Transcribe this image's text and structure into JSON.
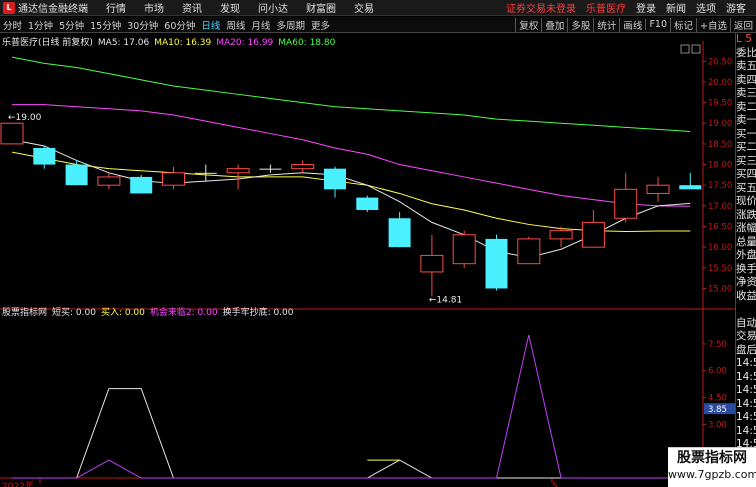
{
  "menu": {
    "app_title": "通达信金融终端",
    "items": [
      "行情",
      "市场",
      "资讯",
      "发现",
      "问小达",
      "财富圈",
      "交易"
    ],
    "alert": "证券交易未登录",
    "stock_link": "乐普医疗",
    "right_items": [
      "登录",
      "新闻",
      "选项"
    ],
    "guest": "游客"
  },
  "periods": [
    "分时",
    "1分钟",
    "5分钟",
    "15分钟",
    "30分钟",
    "60分钟",
    "日线",
    "周线",
    "月线",
    "多周期",
    "更多"
  ],
  "active_period": "日线",
  "tools": [
    "复权",
    "叠加",
    "多股",
    "统计",
    "画线",
    "F10",
    "标记",
    "+自选",
    "返回"
  ],
  "ma_header": {
    "stock": "乐普医疗(日线 前复权)",
    "items": [
      {
        "label": "MA5: 17.06",
        "color": "#e8e8e8"
      },
      {
        "label": "MA10: 16.39",
        "color": "#ffff4a"
      },
      {
        "label": "MA20: 16.99",
        "color": "#ff4aff"
      },
      {
        "label": "MA60: 18.80",
        "color": "#4aff4a"
      }
    ]
  },
  "indicator_header": {
    "name": "股票指标网",
    "items": [
      {
        "label": "短买: 0.00",
        "color": "#e8e8e8"
      },
      {
        "label": "买入: 0.00",
        "color": "#ffff4a"
      },
      {
        "label": "机会来临2: 0.00",
        "color": "#ff4aff"
      },
      {
        "label": "换手牢抄底: 0.00",
        "color": "#e8e8e8"
      }
    ]
  },
  "right_panel": [
    {
      "text": "委比",
      "red": false
    },
    {
      "text": "卖五",
      "red": false
    },
    {
      "text": "卖四",
      "red": false
    },
    {
      "text": "卖三",
      "red": false
    },
    {
      "text": "卖二",
      "red": false
    },
    {
      "text": "卖一",
      "red": false
    },
    {
      "text": "买一",
      "red": false
    },
    {
      "text": "买二",
      "red": false
    },
    {
      "text": "买三",
      "red": false
    },
    {
      "text": "买四",
      "red": false
    },
    {
      "text": "买五",
      "red": false
    },
    {
      "text": "现价",
      "red": false
    },
    {
      "text": "涨跌",
      "red": false
    },
    {
      "text": "涨幅",
      "red": false
    },
    {
      "text": "总量",
      "red": false
    },
    {
      "text": "外盘",
      "red": false
    },
    {
      "text": "换手",
      "red": false
    },
    {
      "text": "净资",
      "red": false
    },
    {
      "text": "收益",
      "red": false
    },
    {
      "text": "",
      "red": false
    },
    {
      "text": "自动",
      "red": false
    },
    {
      "text": "交易",
      "red": false
    },
    {
      "text": "盘后",
      "red": false
    },
    {
      "text": "14:5",
      "red": false
    },
    {
      "text": "14:5",
      "red": false
    },
    {
      "text": "14:5",
      "red": false
    },
    {
      "text": "14:5",
      "red": false
    },
    {
      "text": "14:5",
      "red": false
    },
    {
      "text": "14:5",
      "red": false
    },
    {
      "text": "14:5",
      "red": false
    },
    {
      "text": "14:5",
      "red": false
    },
    {
      "text": "14:5",
      "red": false
    }
  ],
  "right_panel_top": "L 5",
  "price_axis": [
    "20.50",
    "20.00",
    "19.50",
    "19.00",
    "18.50",
    "18.00",
    "17.50",
    "17.00",
    "16.50",
    "16.00",
    "15.50",
    "15.00"
  ],
  "indicator_axis": [
    "7.50",
    "6.00",
    "4.50",
    "3.00",
    "1.50"
  ],
  "indicator_current": "3.85",
  "x_labels": [
    "2022年",
    "5"
  ],
  "annotations": {
    "high": "19.00",
    "low": "14.81"
  },
  "colors": {
    "up": "#ff4a4a",
    "down": "#4af0ff",
    "ma5": "#e8e8e8",
    "ma10": "#ffff4a",
    "ma20": "#ff4aff",
    "ma60": "#4aff4a",
    "axis": "#c01818"
  },
  "watermark": {
    "title": "股票指标网",
    "url": "www.7gpzb.com"
  },
  "chart_data": {
    "type": "candlestick",
    "ylim": [
      14.6,
      20.7
    ],
    "candles": [
      {
        "o": 18.5,
        "c": 19.0,
        "h": 19.0,
        "l": 18.5
      },
      {
        "o": 18.4,
        "c": 18.0,
        "h": 18.45,
        "l": 17.9
      },
      {
        "o": 18.0,
        "c": 17.5,
        "h": 18.1,
        "l": 17.5
      },
      {
        "o": 17.5,
        "c": 17.7,
        "h": 17.8,
        "l": 17.4
      },
      {
        "o": 17.7,
        "c": 17.3,
        "h": 17.75,
        "l": 17.3
      },
      {
        "o": 17.5,
        "c": 17.8,
        "h": 17.95,
        "l": 17.4
      },
      {
        "o": 17.8,
        "c": 17.8,
        "h": 18.0,
        "l": 17.6
      },
      {
        "o": 17.8,
        "c": 17.9,
        "h": 18.0,
        "l": 17.4
      },
      {
        "o": 17.9,
        "c": 17.9,
        "h": 18.0,
        "l": 17.8
      },
      {
        "o": 17.9,
        "c": 18.0,
        "h": 18.1,
        "l": 17.8
      },
      {
        "o": 17.9,
        "c": 17.4,
        "h": 17.95,
        "l": 17.2
      },
      {
        "o": 17.2,
        "c": 16.9,
        "h": 17.25,
        "l": 16.85
      },
      {
        "o": 16.7,
        "c": 16.0,
        "h": 16.85,
        "l": 16.0
      },
      {
        "o": 15.4,
        "c": 15.8,
        "h": 16.3,
        "l": 14.81
      },
      {
        "o": 15.6,
        "c": 16.3,
        "h": 16.4,
        "l": 15.5
      },
      {
        "o": 16.2,
        "c": 15.0,
        "h": 16.3,
        "l": 14.95
      },
      {
        "o": 15.6,
        "c": 16.2,
        "h": 16.25,
        "l": 15.6
      },
      {
        "o": 16.2,
        "c": 16.4,
        "h": 16.5,
        "l": 16.0
      },
      {
        "o": 16.0,
        "c": 16.6,
        "h": 16.9,
        "l": 16.0
      },
      {
        "o": 16.7,
        "c": 17.4,
        "h": 17.8,
        "l": 16.6
      },
      {
        "o": 17.3,
        "c": 17.5,
        "h": 17.7,
        "l": 17.1
      },
      {
        "o": 17.5,
        "c": 17.4,
        "h": 17.8,
        "l": 17.4
      }
    ],
    "ma5": [
      18.6,
      18.45,
      18.1,
      17.8,
      17.6,
      17.55,
      17.6,
      17.65,
      17.75,
      17.8,
      17.75,
      17.5,
      17.1,
      16.6,
      16.3,
      15.9,
      15.75,
      15.95,
      16.3,
      16.7,
      17.0,
      17.06
    ],
    "ma10": [
      18.3,
      18.15,
      18.0,
      17.9,
      17.85,
      17.8,
      17.75,
      17.7,
      17.7,
      17.7,
      17.6,
      17.5,
      17.3,
      17.05,
      16.9,
      16.7,
      16.55,
      16.45,
      16.4,
      16.38,
      16.39,
      16.39
    ],
    "ma20": [
      19.45,
      19.45,
      19.4,
      19.35,
      19.3,
      19.2,
      19.05,
      18.9,
      18.75,
      18.6,
      18.4,
      18.25,
      18.0,
      17.85,
      17.7,
      17.55,
      17.4,
      17.25,
      17.15,
      17.05,
      17.0,
      16.99
    ],
    "ma60": [
      20.6,
      20.45,
      20.35,
      20.2,
      20.05,
      19.9,
      19.8,
      19.7,
      19.6,
      19.5,
      19.4,
      19.35,
      19.3,
      19.25,
      19.2,
      19.1,
      19.05,
      19.0,
      18.95,
      18.9,
      18.85,
      18.8
    ],
    "indicator": {
      "ylim": [
        0,
        8.5
      ],
      "white": [
        0,
        0,
        0,
        5.0,
        5.0,
        0,
        0,
        0,
        0,
        0,
        0,
        0,
        1.0,
        0,
        0,
        0,
        0,
        0,
        0,
        0,
        0,
        0
      ],
      "magenta": [
        0,
        0,
        0,
        1.0,
        0,
        0,
        0,
        0,
        0,
        0,
        0,
        0,
        0,
        0,
        0,
        0,
        8.0,
        0,
        0,
        0,
        0,
        0
      ]
    }
  }
}
